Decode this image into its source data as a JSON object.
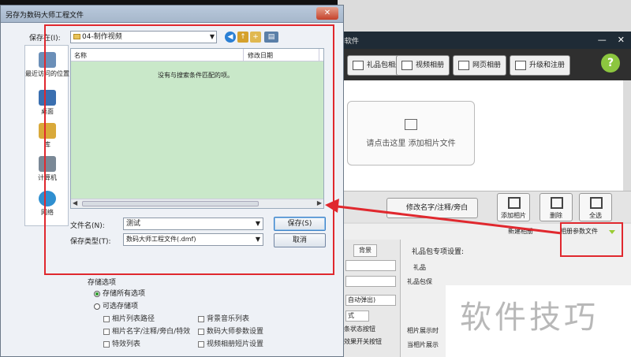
{
  "dialog": {
    "title": "另存为数码大师工程文件",
    "close_label": "✕",
    "save_in_label": "保存在(I):",
    "save_in_value": "04-制作视频",
    "places": [
      {
        "label": "最近访问的位置"
      },
      {
        "label": "桌面"
      },
      {
        "label": "库"
      },
      {
        "label": "计算机"
      },
      {
        "label": "网络"
      }
    ],
    "columns": [
      "名称",
      "修改日期"
    ],
    "empty_message": "没有与搜索条件匹配的项。",
    "filename_label": "文件名(N):",
    "filename_value": "测试",
    "filetype_label": "保存类型(T):",
    "filetype_value": "数码大师工程文件(.dmf)",
    "save_button": "保存(S)",
    "cancel_button": "取消",
    "options_title": "存储选项",
    "radio_all": "存储所有选项",
    "radio_select": "可选存储项",
    "checks": [
      "相片列表路径",
      "背景音乐列表",
      "相片名字/注释/旁白/特效",
      "数码大师参数设置",
      "特效列表",
      "视频相册短片设置"
    ]
  },
  "app": {
    "title_suffix": "作软件",
    "tabs": [
      "礼品包相册",
      "视频相册",
      "网页相册",
      "升级和注册"
    ],
    "help": "?",
    "drop_text": "请点击这里 添加相片文件",
    "edit_button": "修改名字/注释/旁白",
    "tools": [
      "添加相片",
      "删除",
      "全选"
    ],
    "new_album": "新建相册",
    "album_params": "相册参数文件",
    "bg_tab": "背景",
    "gift_settings": "礼品包专项设置:",
    "gift_rows": [
      "礼品",
      "礼品包保"
    ],
    "auto_popup": "自动弹出)",
    "left_snips": [
      "式",
      "条状态按钮",
      "效果开关按钮"
    ],
    "right_snips": [
      "相片展示时",
      "当相片展示"
    ]
  },
  "watermark": "软件技巧",
  "colors": {
    "annotation_red": "#e0282e",
    "file_list_bg": "#c9e8c9",
    "app_title_bg": "#1f2b36"
  }
}
